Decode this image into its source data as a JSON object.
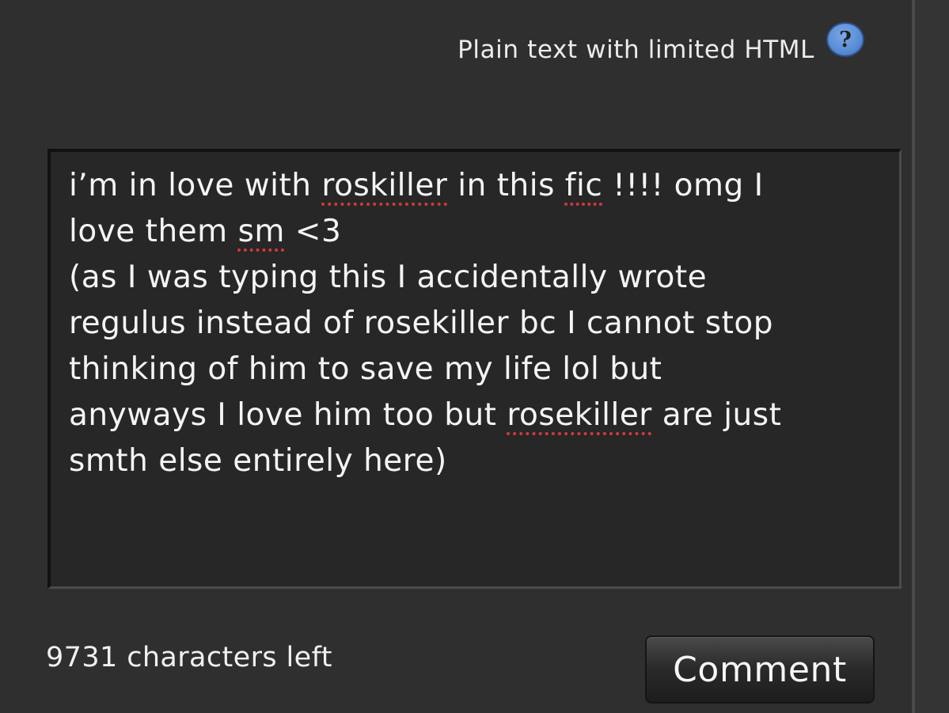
{
  "header": {
    "format_label": "Plain text with limited HTML",
    "help_icon": "?"
  },
  "comment": {
    "segments": [
      {
        "text": "i’m in love with ",
        "misspelled": false
      },
      {
        "text": "roskiller",
        "misspelled": true
      },
      {
        "text": " in this ",
        "misspelled": false
      },
      {
        "text": "fic",
        "misspelled": true
      },
      {
        "text": " !!!! omg I\nlove them ",
        "misspelled": false
      },
      {
        "text": "sm",
        "misspelled": true
      },
      {
        "text": " <3\n(as I was typing this I accidentally wrote\nregulus instead of rosekiller bc I cannot stop\nthinking of him to save my life lol but\nanyways I love him too but ",
        "misspelled": false
      },
      {
        "text": "rosekiller",
        "misspelled": true
      },
      {
        "text": " are just\nsmth else entirely here)",
        "misspelled": false
      }
    ]
  },
  "footer": {
    "characters_left": "9731 characters left",
    "submit_label": "Comment"
  },
  "colors": {
    "background": "#2f2f2f",
    "textarea_background": "#272727",
    "help_button": "#5b8fd6",
    "spellcheck_underline": "#d03a3a"
  },
  "icons": {
    "help": "question-mark-icon"
  }
}
